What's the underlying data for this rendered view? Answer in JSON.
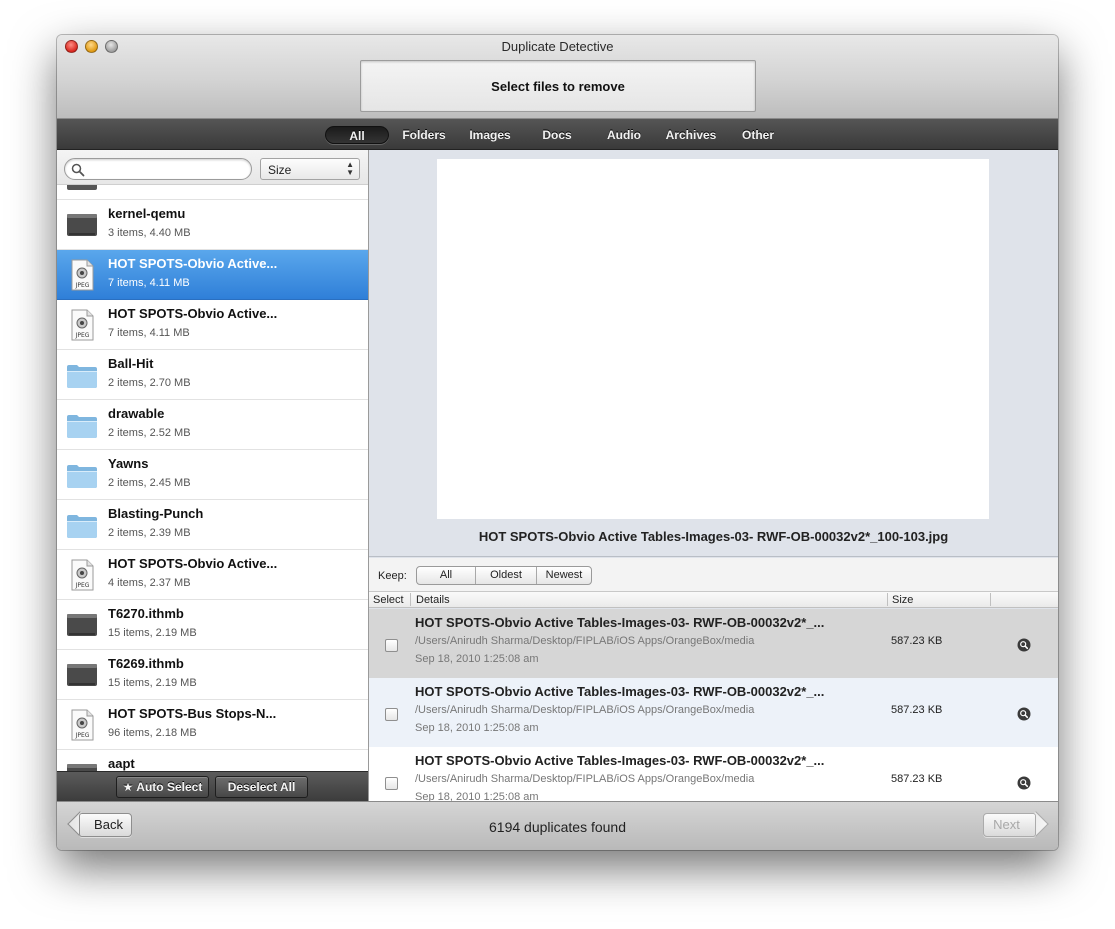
{
  "window": {
    "title": "Duplicate Detective",
    "step_label": "Select files to remove"
  },
  "filters": [
    {
      "label": "All",
      "active": true
    },
    {
      "label": "Folders",
      "active": false
    },
    {
      "label": "Images",
      "active": false
    },
    {
      "label": "Docs",
      "active": false
    },
    {
      "label": "Audio",
      "active": false
    },
    {
      "label": "Archives",
      "active": false
    },
    {
      "label": "Other",
      "active": false
    }
  ],
  "sidebar": {
    "search_placeholder": "",
    "sort_value": "Size",
    "items": [
      {
        "name": "kernel-qemu",
        "meta": "3 items, 4.40 MB",
        "icon": "generic-file-icon",
        "selected": false
      },
      {
        "name": "HOT SPOTS-Obvio Active...",
        "meta": "7 items, 4.11 MB",
        "icon": "jpeg-file-icon",
        "selected": true
      },
      {
        "name": "HOT SPOTS-Obvio Active...",
        "meta": "7 items, 4.11 MB",
        "icon": "jpeg-file-icon",
        "selected": false
      },
      {
        "name": "Ball-Hit",
        "meta": "2 items, 2.70 MB",
        "icon": "folder-icon",
        "selected": false
      },
      {
        "name": "drawable",
        "meta": "2 items, 2.52 MB",
        "icon": "folder-icon",
        "selected": false
      },
      {
        "name": "Yawns",
        "meta": "2 items, 2.45 MB",
        "icon": "folder-icon",
        "selected": false
      },
      {
        "name": "Blasting-Punch",
        "meta": "2 items, 2.39 MB",
        "icon": "folder-icon",
        "selected": false
      },
      {
        "name": "HOT SPOTS-Obvio Active...",
        "meta": "4 items, 2.37 MB",
        "icon": "jpeg-file-icon",
        "selected": false
      },
      {
        "name": "T6270.ithmb",
        "meta": "15 items, 2.19 MB",
        "icon": "generic-file-icon",
        "selected": false
      },
      {
        "name": "T6269.ithmb",
        "meta": "15 items, 2.19 MB",
        "icon": "generic-file-icon",
        "selected": false
      },
      {
        "name": "HOT SPOTS-Bus Stops-N...",
        "meta": "96 items, 2.18 MB",
        "icon": "jpeg-file-icon",
        "selected": false
      },
      {
        "name": "aapt",
        "meta": "",
        "icon": "generic-file-icon",
        "selected": false
      }
    ],
    "auto_select_label": "★ Auto Select",
    "deselect_all_label": "Deselect All"
  },
  "preview": {
    "filename": "HOT SPOTS-Obvio Active Tables-Images-03- RWF-OB-00032v2*_100-103.jpg"
  },
  "keep": {
    "label": "Keep:",
    "options": [
      "All",
      "Oldest",
      "Newest"
    ]
  },
  "table": {
    "headers": {
      "select": "Select",
      "details": "Details",
      "size": "Size"
    },
    "rows": [
      {
        "title": "HOT SPOTS-Obvio Active Tables-Images-03- RWF-OB-00032v2*_...",
        "path": "/Users/Anirudh Sharma/Desktop/FIPLAB/iOS Apps/OrangeBox/media",
        "date": "Sep 18, 2010 1:25:08 am",
        "size": "587.23 KB",
        "bg": "#d6d6d6"
      },
      {
        "title": "HOT SPOTS-Obvio Active Tables-Images-03- RWF-OB-00032v2*_...",
        "path": "/Users/Anirudh Sharma/Desktop/FIPLAB/iOS Apps/OrangeBox/media",
        "date": "Sep 18, 2010 1:25:08 am",
        "size": "587.23 KB",
        "bg": "#edf2f9"
      },
      {
        "title": "HOT SPOTS-Obvio Active Tables-Images-03- RWF-OB-00032v2*_...",
        "path": "/Users/Anirudh Sharma/Desktop/FIPLAB/iOS Apps/OrangeBox/media",
        "date": "Sep 18, 2010 1:25:08 am",
        "size": "587.23 KB",
        "bg": "#ffffff"
      }
    ]
  },
  "bottom": {
    "back_label": "Back",
    "next_label": "Next",
    "status": "6194 duplicates found"
  }
}
